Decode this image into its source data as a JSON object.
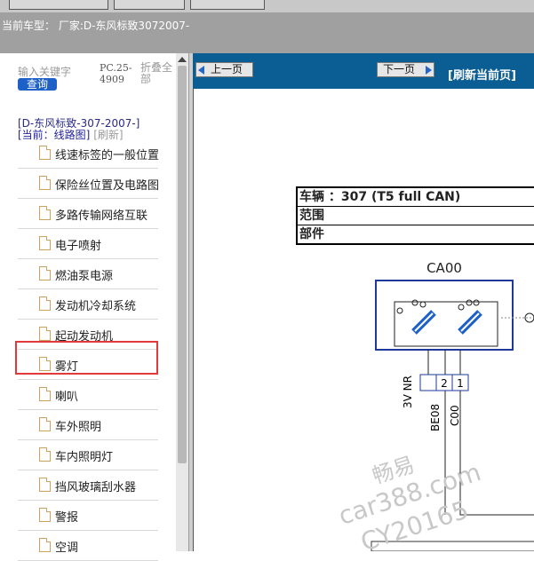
{
  "header": {
    "current_model": "当前车型： 厂家:D-东风标致3072007-"
  },
  "sidebar": {
    "keyword_placeholder": "输入关键字",
    "query_button": "查询",
    "pc_code": "PC.25-4909",
    "fold_all": "折叠全部",
    "model_tree": "[D-东风标致-307-2007-]",
    "current_label": "[当前：线路图]",
    "refresh_label": "[刷新]",
    "items": [
      {
        "label": "线速标签的一般位置"
      },
      {
        "label": "保险丝位置及电路图"
      },
      {
        "label": "多路传输网络互联"
      },
      {
        "label": "电子喷射"
      },
      {
        "label": "燃油泵电源"
      },
      {
        "label": "发动机冷却系统"
      },
      {
        "label": "起动发动机"
      },
      {
        "label": "雾灯"
      },
      {
        "label": "喇叭"
      },
      {
        "label": "车外照明"
      },
      {
        "label": "车内照明灯"
      },
      {
        "label": "挡风玻璃刮水器"
      },
      {
        "label": "警报"
      },
      {
        "label": "空调"
      }
    ],
    "highlighted_item": "发动机冷却系统"
  },
  "toolbar": {
    "prev_page": "上一页",
    "next_page": "下一页",
    "refresh_page": "[刷新当前页]"
  },
  "document": {
    "vehicle_row": "车辆 ：307 (T5 full CAN)",
    "scope_row": "范围",
    "part_row": "部件",
    "connector_code": "CA00",
    "pin_2": "2",
    "pin_1": "1",
    "wire_3v_nr": "3V NR",
    "wire_be08": "BE08",
    "wire_c00": "C00"
  },
  "watermark": {
    "line1": "畅易",
    "line2": "car388.com",
    "line3": "CY20165"
  },
  "colors": {
    "nav_bar": "#0b5e94",
    "query_button": "#1d61c8",
    "highlight_border": "#e23a3a",
    "switch_blue": "#1d61c8"
  }
}
